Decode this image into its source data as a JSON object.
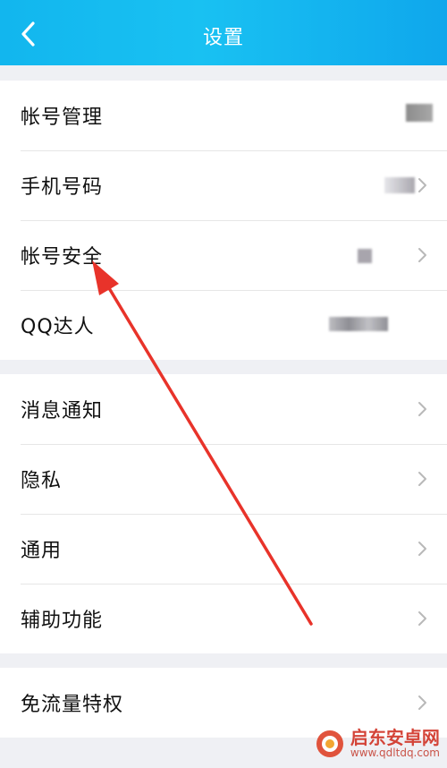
{
  "header": {
    "title": "设置"
  },
  "groups": [
    {
      "items": [
        {
          "label": "帐号管理"
        },
        {
          "label": "手机号码"
        },
        {
          "label": "帐号安全"
        },
        {
          "label": "QQ达人"
        }
      ]
    },
    {
      "items": [
        {
          "label": "消息通知"
        },
        {
          "label": "隐私"
        },
        {
          "label": "通用"
        },
        {
          "label": "辅助功能"
        }
      ]
    },
    {
      "items": [
        {
          "label": "免流量特权"
        }
      ]
    }
  ],
  "watermark": {
    "title": "启东安卓网",
    "url": "www.qdltdq.com"
  },
  "colors": {
    "header_bg": "#14b7ef",
    "page_bg": "#eff0f4",
    "annotation_arrow": "#e8332a"
  }
}
